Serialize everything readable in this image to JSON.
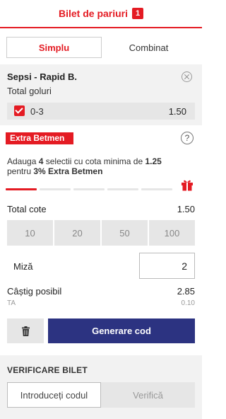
{
  "header": {
    "title": "Bilet de pariuri",
    "count": "1",
    "accent": "#e41b23"
  },
  "tabs": [
    {
      "label": "Simplu",
      "active": true
    },
    {
      "label": "Combinat",
      "active": false
    }
  ],
  "bet": {
    "event": "Sepsi - Rapid B.",
    "market": "Total goluri",
    "selection": "0-3",
    "odd": "1.50",
    "checked": true
  },
  "extra_betmen": {
    "badge": "Extra Betmen",
    "text_part1": "Adauga ",
    "count": "4",
    "text_part2": " selectii cu cota minima de ",
    "min_odd": "1.25",
    "text_part3": "pentru ",
    "bonus": "3% Extra Betmen",
    "progress_filled": 1,
    "progress_total": 5
  },
  "summary": {
    "total_cote_label": "Total cote",
    "total_cote_value": "1.50",
    "quick_stakes": [
      "10",
      "20",
      "50",
      "100"
    ],
    "miza_label": "Miză",
    "miza_value": "2",
    "castig_label": "Câștig posibil",
    "castig_value": "2.85",
    "ta_label": "TA",
    "ta_value": "0.10"
  },
  "actions": {
    "generate_label": "Generare cod",
    "generate_color": "#2c3381"
  },
  "verify": {
    "title": "VERIFICARE BILET",
    "input_placeholder": "Introduceți codul",
    "button_label": "Verifică"
  },
  "icons": {
    "close": "close-circle-icon",
    "help": "question-circle-icon",
    "gift": "gift-icon",
    "delete": "trash-icon",
    "check": "checkbox-checked-icon"
  }
}
